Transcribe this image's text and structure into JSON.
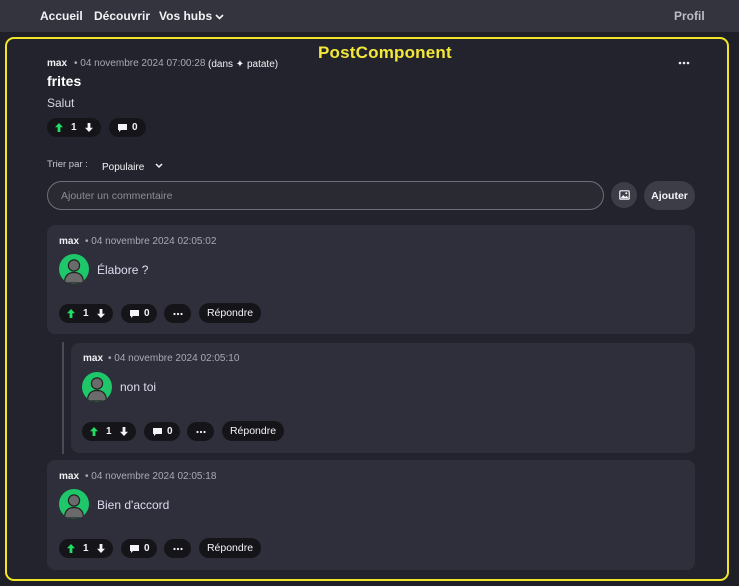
{
  "nav": {
    "home": "Accueil",
    "discover": "Découvrir",
    "hubs": "Vos hubs",
    "profile": "Profil"
  },
  "panel_label": "PostComponent",
  "post": {
    "author": "max",
    "date": "• 04 novembre 2024 07:00:28",
    "hub": "(dans ✦ patate)",
    "title": "frites",
    "body": "Salut",
    "votes": "1",
    "comments": "0"
  },
  "sort": {
    "label": "Trier par :",
    "value": "Populaire"
  },
  "new_comment": {
    "placeholder": "Ajouter un commentaire",
    "submit": "Ajouter"
  },
  "reply_label": "Répondre",
  "comments": [
    {
      "author": "max",
      "date": "• 04 novembre 2024 02:05:02",
      "text": "Élabore ?",
      "votes": "1",
      "comments": "0"
    },
    {
      "author": "max",
      "date": "• 04 novembre 2024 02:05:10",
      "text": "non toi",
      "votes": "1",
      "comments": "0"
    },
    {
      "author": "max",
      "date": "• 04 novembre 2024 02:05:18",
      "text": "Bien d'accord",
      "votes": "1",
      "comments": "0"
    }
  ],
  "colors": {
    "accent_panel": "#f0e528",
    "upvote": "#22dd66",
    "avatar": "#1ec76a"
  }
}
